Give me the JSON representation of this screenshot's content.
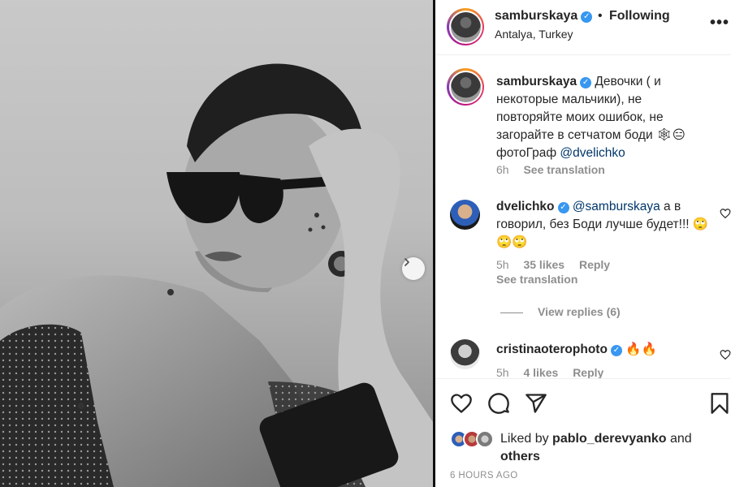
{
  "post": {
    "username": "samburskaya",
    "location": "Antalya, Turkey",
    "dot": "•",
    "follow_label": "Following",
    "more": "•••",
    "verified_mark": "✓"
  },
  "caption": {
    "username": "samburskaya",
    "text": " Девочки ( и некоторые мальчики), не повторяйте моих ошибок, не загорайте в сетчатом боди 🕸😑 фотоГраф ",
    "mention": "@dvelichko",
    "time": "6h",
    "translate": "See translation"
  },
  "comments": [
    {
      "username": "dvelichko",
      "mention": "@samburskaya",
      "text": " а в говорил, без Боди лучше будет!!! 🙄🙄🙄",
      "time": "5h",
      "likes": "35 likes",
      "reply": "Reply",
      "translate": "See translation",
      "view_replies": "View replies (6)"
    },
    {
      "username": "cristinaoterophoto",
      "text": " 🔥🔥",
      "time": "5h",
      "likes": "4 likes",
      "reply": "Reply"
    }
  ],
  "likes": {
    "prefix": "Liked by ",
    "user": "pablo_derevyanko",
    "suffix": " and",
    "others": "others"
  },
  "timestamp": "6 HOURS AGO",
  "colors": {
    "verified": "#3897f0",
    "mention": "#00376b",
    "muted": "#8e8e8e",
    "text": "#262626"
  },
  "icons": [
    "chevron-right-icon",
    "heart-icon",
    "comment-icon",
    "share-icon",
    "bookmark-icon",
    "more-icon",
    "verified-icon"
  ]
}
